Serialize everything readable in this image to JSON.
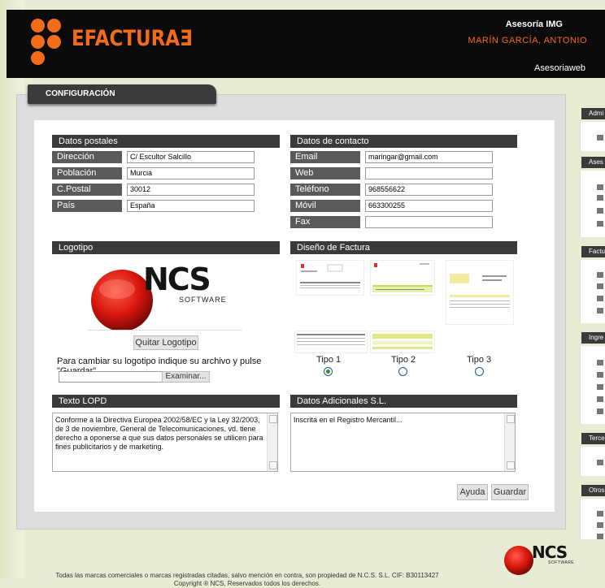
{
  "header": {
    "brand": "EFACTURAƎ",
    "company": "Asesoría IMG",
    "user": "MARÍN GARCÍA, ANTONIO",
    "link": "Asesoriaweb"
  },
  "tab_title": "CONFIGURACIÓN",
  "postal": {
    "title": "Datos postales",
    "fields": [
      {
        "label": "Dirección",
        "value": "C/ Escultor Salcillo"
      },
      {
        "label": "Población",
        "value": "Murcia"
      },
      {
        "label": "C.Postal",
        "value": "30012"
      },
      {
        "label": "País",
        "value": "España"
      }
    ]
  },
  "contact": {
    "title": "Datos de contacto",
    "fields": [
      {
        "label": "Email",
        "value": "maringar@gmail.com"
      },
      {
        "label": "Web",
        "value": ""
      },
      {
        "label": "Teléfono",
        "value": "968556622"
      },
      {
        "label": "Móvil",
        "value": "663300255"
      },
      {
        "label": "Fax",
        "value": ""
      }
    ]
  },
  "logo": {
    "title": "Logotipo",
    "logo_text": "NCS",
    "logo_sub": "SOFTWARE",
    "remove_button": "Quitar Logotipo",
    "hint": "Para cambiar su logotipo indique su archivo y pulse \"Guardar\".",
    "browse_button": "Examinar..."
  },
  "design": {
    "title": "Diseño de Factura",
    "options": [
      {
        "label": "Tipo 1",
        "selected": true
      },
      {
        "label": "Tipo 2",
        "selected": false
      },
      {
        "label": "Tipo 3",
        "selected": false
      }
    ]
  },
  "lopd": {
    "title": "Texto LOPD",
    "text": "Conforme a la Directiva Europea 2002/58/EC y la Ley 32/2003, de 3 de noviembre, General de Telecomunicaciones, vd. tiene derecho a oponerse a que sus datos personales se utilicen para fines publicitarios y de marketing."
  },
  "extra": {
    "title": "Datos Adicionales S.L.",
    "text": "Inscrita en el Registro Mercantil..."
  },
  "actions": {
    "help": "Ayuda",
    "save": "Guardar"
  },
  "right_sidebar": [
    "Admi",
    "Ases",
    "Factu",
    "Ingre",
    "Terce",
    "Otros"
  ],
  "footer": {
    "line1": "Todas las marcas comerciales o marcas registradas citadas, salvo mención en contra, son propiedad de N.C.S. S.L. CIF: B30113427",
    "line2": "Copyright ® NCS, Reservados todos los derechos.",
    "logo_text": "NCS",
    "logo_sub": "SOFTWARE"
  },
  "colors": {
    "accent": "#f36c1c",
    "header_bg": "#0b0b0b",
    "section_bg": "#3a3a3a"
  }
}
